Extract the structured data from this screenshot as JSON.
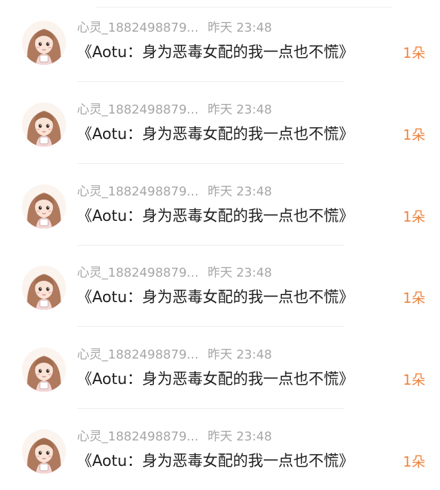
{
  "messages": [
    {
      "name": "心灵_1882498879...",
      "time": "昨天 23:48",
      "title": "《Aotu：身为恶毒女配的我一点也不慌》",
      "count": "1朵",
      "avatar_icon": "girl-avatar-icon"
    },
    {
      "name": "心灵_1882498879...",
      "time": "昨天 23:48",
      "title": "《Aotu：身为恶毒女配的我一点也不慌》",
      "count": "1朵",
      "avatar_icon": "girl-avatar-icon"
    },
    {
      "name": "心灵_1882498879...",
      "time": "昨天 23:48",
      "title": "《Aotu：身为恶毒女配的我一点也不慌》",
      "count": "1朵",
      "avatar_icon": "girl-avatar-icon"
    },
    {
      "name": "心灵_1882498879...",
      "time": "昨天 23:48",
      "title": "《Aotu：身为恶毒女配的我一点也不慌》",
      "count": "1朵",
      "avatar_icon": "girl-avatar-icon"
    },
    {
      "name": "心灵_1882498879...",
      "time": "昨天 23:48",
      "title": "《Aotu：身为恶毒女配的我一点也不慌》",
      "count": "1朵",
      "avatar_icon": "girl-avatar-icon"
    },
    {
      "name": "心灵_1882498879...",
      "time": "昨天 23:48",
      "title": "《Aotu：身为恶毒女配的我一点也不慌》",
      "count": "1朵",
      "avatar_icon": "girl-avatar-icon"
    }
  ],
  "colors": {
    "background": "#ffffff",
    "meta_text": "#a6a6a6",
    "title_text": "#1e1e1e",
    "count_accent": "#f0823c",
    "divider": "#ececec"
  }
}
